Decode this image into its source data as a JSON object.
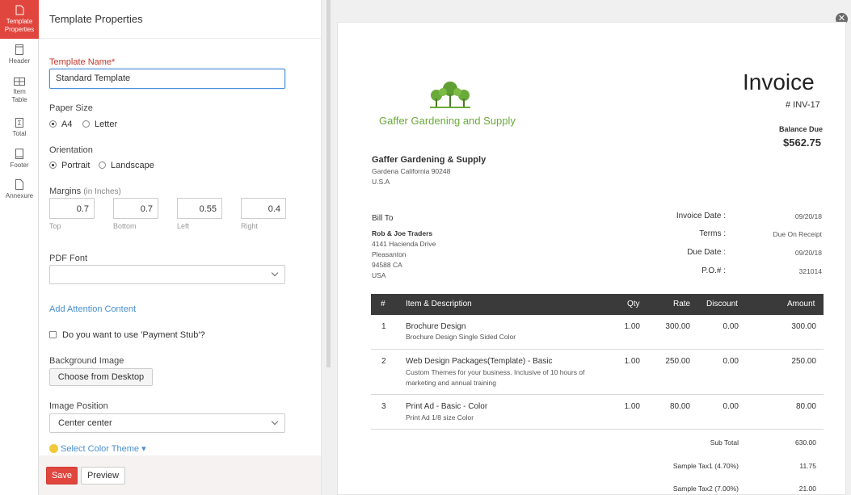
{
  "rail": {
    "items": [
      {
        "label_line1": "Template",
        "label_line2": "Properties"
      },
      {
        "label_line1": "Header",
        "label_line2": ""
      },
      {
        "label_line1": "Item",
        "label_line2": "Table"
      },
      {
        "label_line1": "Total",
        "label_line2": ""
      },
      {
        "label_line1": "Footer",
        "label_line2": ""
      },
      {
        "label_line1": "Annexure",
        "label_line2": ""
      }
    ]
  },
  "panel": {
    "title": "Template Properties",
    "template_name_label": "Template Name*",
    "template_name_value": "Standard Template",
    "paper_size_label": "Paper Size",
    "paper_a4": "A4",
    "paper_letter": "Letter",
    "orientation_label": "Orientation",
    "orientation_portrait": "Portrait",
    "orientation_landscape": "Landscape",
    "margins_label": "Margins",
    "margins_unit": "(in Inches)",
    "margins": {
      "top": "0.7",
      "bottom": "0.7",
      "left": "0.55",
      "right": "0.4"
    },
    "margin_top_label": "Top",
    "margin_bottom_label": "Bottom",
    "margin_left_label": "Left",
    "margin_right_label": "Right",
    "pdf_font_label": "PDF Font",
    "pdf_font_value": "",
    "attention_link": "Add Attention Content",
    "payment_stub_label": "Do you want to use 'Payment Stub'?",
    "bg_image_label": "Background Image",
    "choose_button": "Choose from Desktop",
    "image_position_label": "Image Position",
    "image_position_value": "Center center",
    "color_theme_link": "Select Color Theme",
    "save_button": "Save",
    "preview_button": "Preview"
  },
  "invoice": {
    "title": "Invoice",
    "number": "# INV-17",
    "balance_due_label": "Balance Due",
    "balance_due_value": "$562.75",
    "company_logo_text": "Gaffer Gardening and Supply",
    "company_name": "Gaffer Gardening & Supply",
    "company_addr1": "Gardena California 90248",
    "company_addr2": "U.S.A",
    "bill_to_label": "Bill To",
    "client_name": "Rob & Joe Traders",
    "client_addr1": "4141 Hacienda Drive",
    "client_addr2": "Pleasanton",
    "client_addr3": "94588 CA",
    "client_addr4": "USA",
    "meta": [
      {
        "label": "Invoice Date :",
        "value": "09/20/18"
      },
      {
        "label": "Terms :",
        "value": "Due On Receipt"
      },
      {
        "label": "Due Date :",
        "value": "09/20/18"
      },
      {
        "label": "P.O.# :",
        "value": "321014"
      }
    ],
    "columns": {
      "num": "#",
      "item": "Item & Description",
      "qty": "Qty",
      "rate": "Rate",
      "discount": "Discount",
      "amount": "Amount"
    },
    "items": [
      {
        "num": "1",
        "name": "Brochure Design",
        "desc1": "Brochure Design Single Sided Color",
        "desc2": "",
        "qty": "1.00",
        "rate": "300.00",
        "discount": "0.00",
        "amount": "300.00"
      },
      {
        "num": "2",
        "name": "Web Design Packages(Template) - Basic",
        "desc1": "Custom Themes for your business. Inclusive of 10 hours of",
        "desc2": "marketing and annual training",
        "qty": "1.00",
        "rate": "250.00",
        "discount": "0.00",
        "amount": "250.00"
      },
      {
        "num": "3",
        "name": "Print Ad - Basic - Color",
        "desc1": "Print Ad 1/8 size Color",
        "desc2": "",
        "qty": "1.00",
        "rate": "80.00",
        "discount": "0.00",
        "amount": "80.00"
      }
    ],
    "totals": [
      {
        "label": "Sub Total",
        "value": "630.00"
      },
      {
        "label": "Sample Tax1 (4.70%)",
        "value": "11.75"
      },
      {
        "label": "Sample Tax2 (7.00%)",
        "value": "21.00"
      }
    ]
  },
  "colors": {
    "accent": "#e0463e",
    "link": "#4a8fcf",
    "table_header": "#3a3a3a",
    "logo_green": "#6aaa3a"
  }
}
